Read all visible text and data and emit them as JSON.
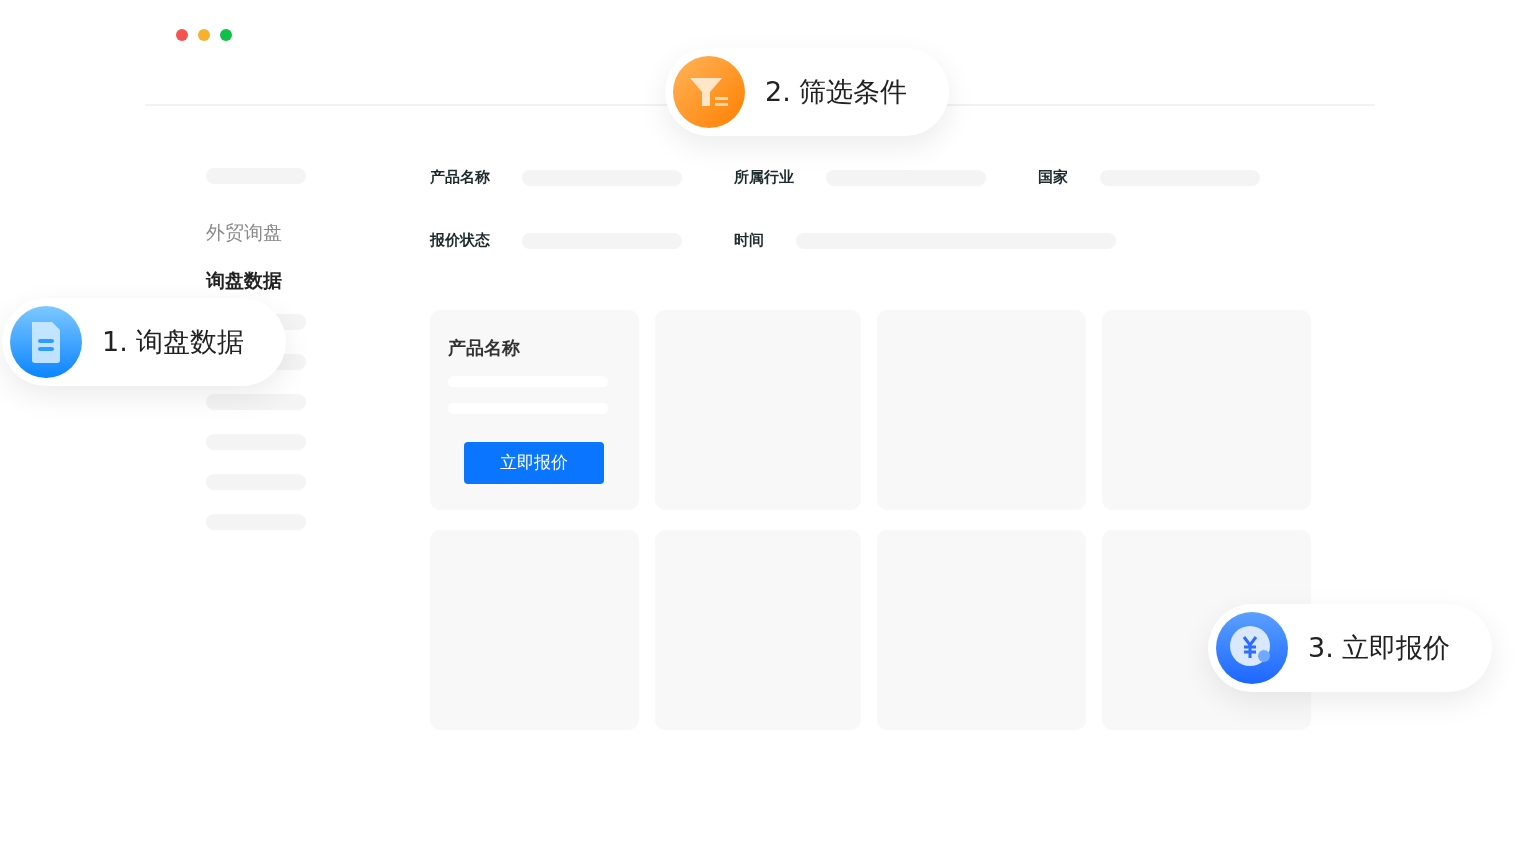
{
  "sidebar": {
    "items": [
      {
        "label": "外贸询盘",
        "selected": false
      },
      {
        "label": "询盘数据",
        "selected": true
      }
    ]
  },
  "filters": [
    {
      "label": "产品名称",
      "wide": false
    },
    {
      "label": "所属行业",
      "wide": false
    },
    {
      "label": "国家",
      "wide": false
    },
    {
      "label": "报价状态",
      "wide": false
    },
    {
      "label": "时间",
      "wide": true
    }
  ],
  "cards": [
    {
      "kind": "product",
      "title": "产品名称",
      "button": "立即报价"
    },
    {
      "kind": "placeholder"
    },
    {
      "kind": "placeholder"
    },
    {
      "kind": "placeholder"
    },
    {
      "kind": "placeholder"
    },
    {
      "kind": "placeholder"
    },
    {
      "kind": "placeholder"
    },
    {
      "kind": "placeholder"
    }
  ],
  "callouts": [
    {
      "kind": "document",
      "label": "1. 询盘数据"
    },
    {
      "kind": "filter",
      "label": "2. 筛选条件"
    },
    {
      "kind": "quote",
      "label": "3. 立即报价"
    }
  ]
}
